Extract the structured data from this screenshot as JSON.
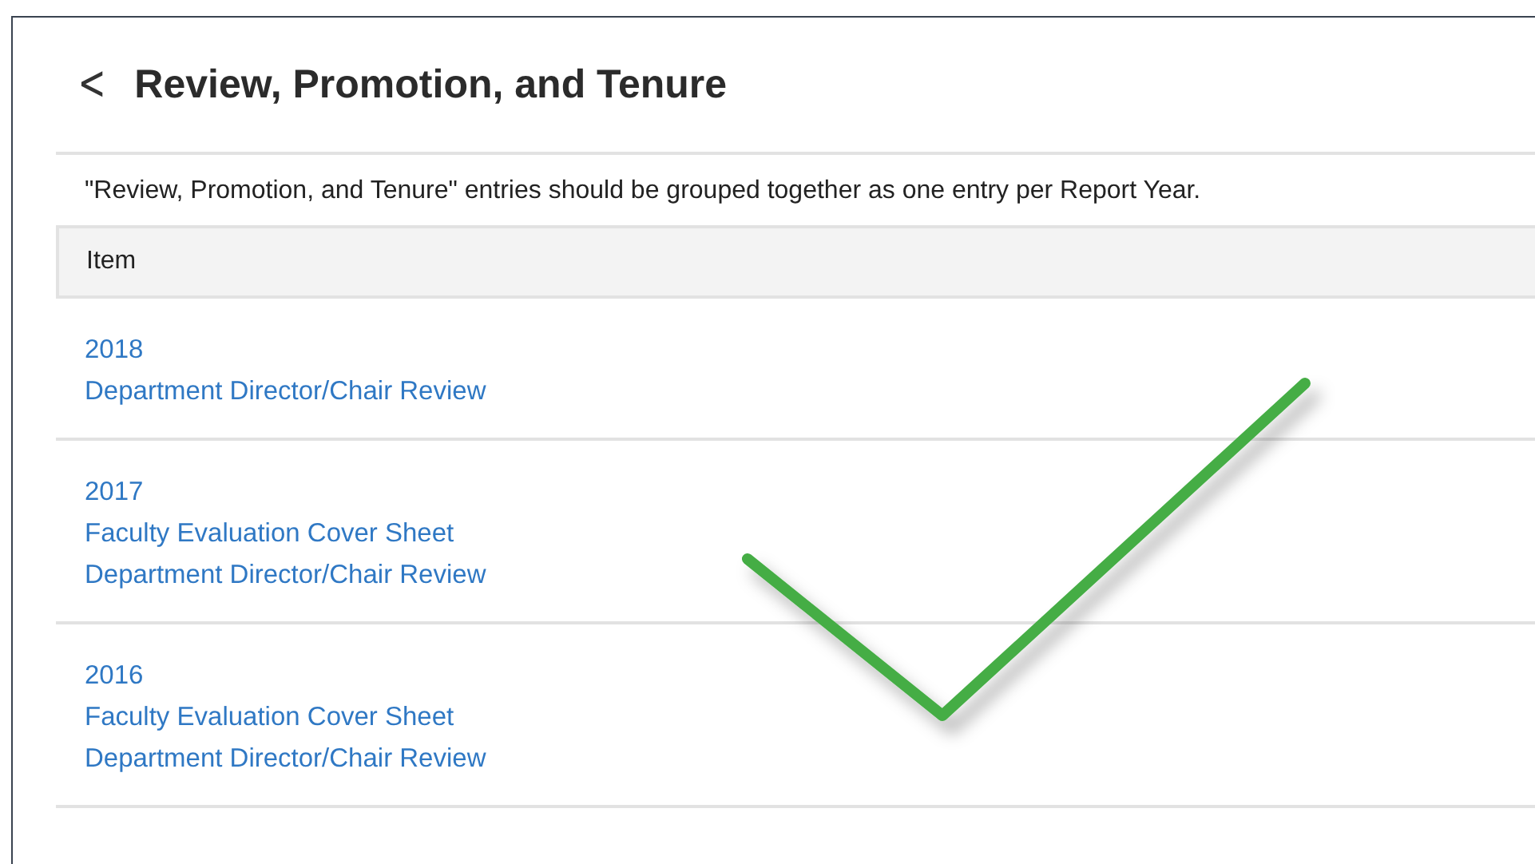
{
  "page": {
    "back": "<",
    "title": "Review, Promotion, and Tenure",
    "note": "\"Review, Promotion, and Tenure\" entries should be grouped together as one entry per Report Year."
  },
  "table": {
    "columns": [
      "Item"
    ],
    "rows": [
      {
        "year": "2018",
        "links": [
          "Department Director/Chair Review"
        ]
      },
      {
        "year": "2017",
        "links": [
          "Faculty Evaluation Cover Sheet",
          "Department Director/Chair Review"
        ]
      },
      {
        "year": "2016",
        "links": [
          "Faculty Evaluation Cover Sheet",
          "Department Director/Chair Review"
        ]
      }
    ]
  }
}
